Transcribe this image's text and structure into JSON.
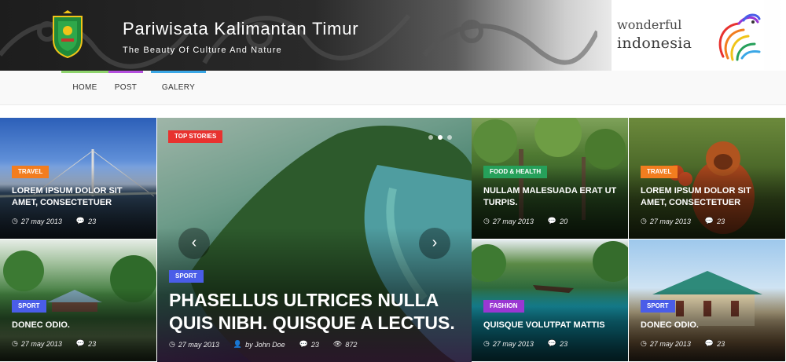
{
  "header": {
    "site_title": "Pariwisata Kalimantan Timur",
    "tagline": "The Beauty Of Culture And Nature",
    "emblem_icon": "east-kalimantan-emblem-icon",
    "partner_logo": {
      "line1": "wonderful",
      "line2": "indonesia"
    }
  },
  "nav": {
    "items": [
      {
        "label": "HOME",
        "accent": "#8ed36c"
      },
      {
        "label": "POST",
        "accent": "#b44fde"
      },
      {
        "label": "GALERY",
        "accent": "#3aa7e6"
      }
    ]
  },
  "icons": {
    "date": "clock-icon",
    "comments": "comment-icon",
    "author": "user-icon",
    "views": "eye-icon"
  },
  "featured": {
    "category": "TOP STORIES",
    "category_color": "#e8322f",
    "slide_category": "SPORT",
    "slide_category_color": "#4a5de8",
    "title": "PHASELLUS ULTRICES NULLA QUIS NIBH. QUISQUE A LECTUS.",
    "date": "27 may 2013",
    "author": "by John Doe",
    "comments": "23",
    "views": "872",
    "slider_dots": 3,
    "active_dot": 2,
    "prev_label": "‹",
    "next_label": "›"
  },
  "tiles": [
    {
      "category": "TRAVEL",
      "category_color": "#f27d1f",
      "title": "LOREM IPSUM DOLOR SIT AMET, CONSECTETUER",
      "date": "27 may 2013",
      "comments": "23"
    },
    {
      "category": "SPORT",
      "category_color": "#4a5de8",
      "title": "DONEC ODIO.",
      "date": "27 may 2013",
      "comments": "23"
    },
    {
      "category": "FOOD & HEALTH",
      "category_color": "#26a05a",
      "title": "NULLAM MALESUADA ERAT UT TURPIS.",
      "date": "27 may 2013",
      "comments": "20"
    },
    {
      "category": "TRAVEL",
      "category_color": "#f27d1f",
      "title": "LOREM IPSUM DOLOR SIT AMET, CONSECTETUER",
      "date": "27 may 2013",
      "comments": "23"
    },
    {
      "category": "FASHION",
      "category_color": "#9a37d2",
      "title": "QUISQUE VOLUTPAT MATTIS",
      "date": "27 may 2013",
      "comments": "23"
    },
    {
      "category": "SPORT",
      "category_color": "#4a5de8",
      "title": "DONEC ODIO.",
      "date": "27 may 2013",
      "comments": "23"
    }
  ]
}
